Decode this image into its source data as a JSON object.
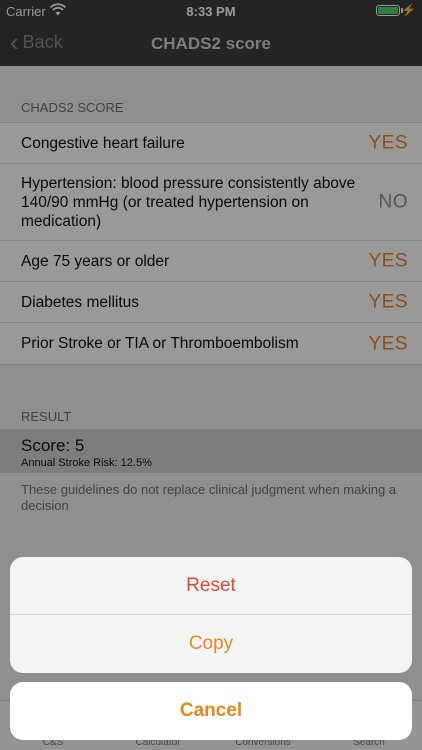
{
  "status_bar": {
    "carrier": "Carrier",
    "time": "8:33 PM"
  },
  "nav": {
    "back_label": "Back",
    "title": "CHADS2 score"
  },
  "chads2": {
    "header": "CHADS2 SCORE",
    "rows": [
      {
        "label": "Congestive heart failure",
        "value": "YES"
      },
      {
        "label": "Hypertension: blood pressure consistently above 140/90 mmHg (or treated hypertension on medication)",
        "value": "NO"
      },
      {
        "label": "Age 75 years or older",
        "value": "YES"
      },
      {
        "label": "Diabetes mellitus",
        "value": "YES"
      },
      {
        "label": "Prior Stroke or TIA or Thromboembolism",
        "value": "YES"
      }
    ]
  },
  "result": {
    "header": "RESULT",
    "score": "Score: 5",
    "risk": "Annual Stroke Risk: 12.5%",
    "disclaimer": "These guidelines do not replace clinical judgment when making a decision"
  },
  "tabs": [
    "C&S",
    "Calculator",
    "Conversions",
    "Search"
  ],
  "action_sheet": {
    "reset_label": "Reset",
    "copy_label": "Copy",
    "cancel_label": "Cancel"
  },
  "colors": {
    "accent": "#e4891d",
    "destructive": "#e0453a"
  }
}
